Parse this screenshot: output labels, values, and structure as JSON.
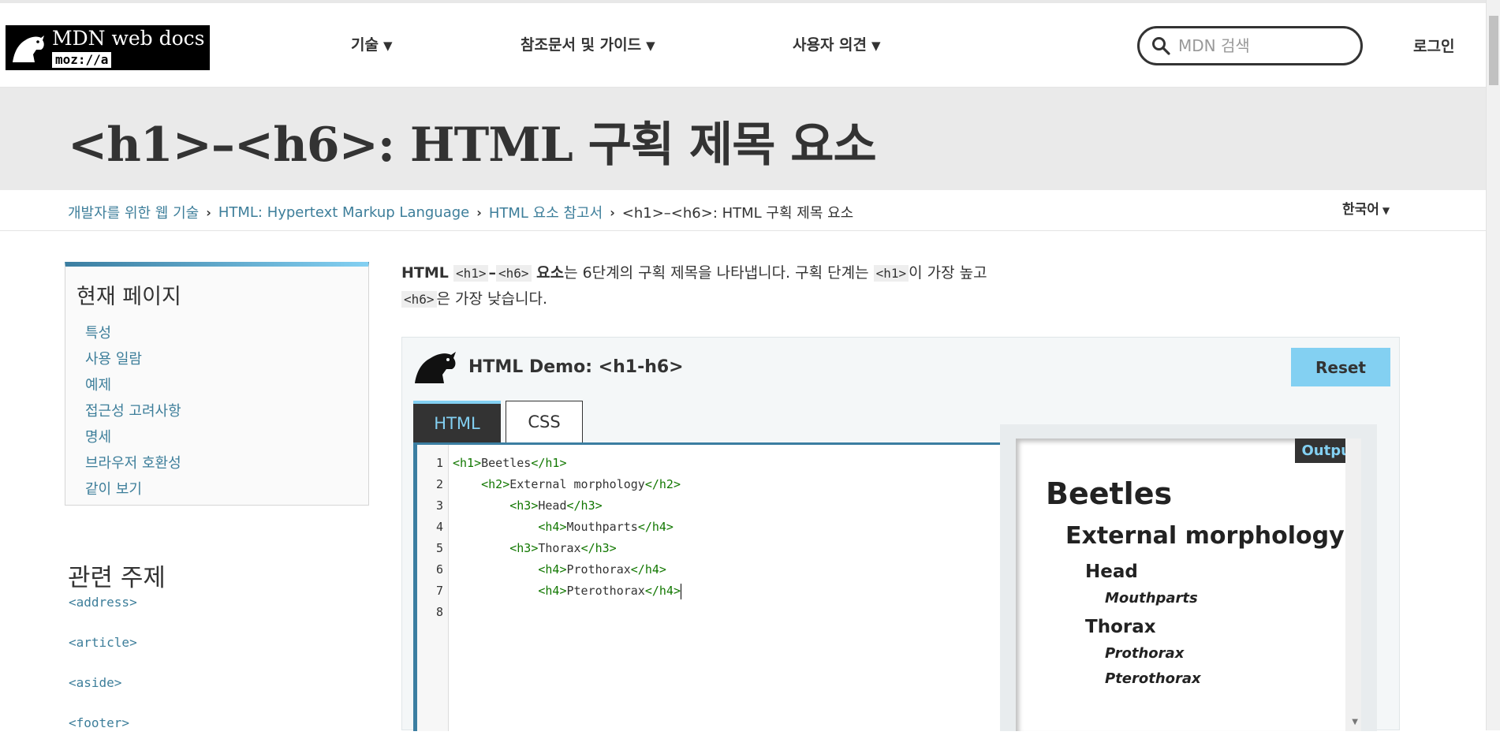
{
  "header": {
    "logo_title": "MDN web docs",
    "logo_sub": "moz://a",
    "nav": [
      {
        "label": "기술"
      },
      {
        "label": "참조문서 및 가이드"
      },
      {
        "label": "사용자 의견"
      }
    ],
    "search_placeholder": "MDN 검색",
    "login": "로그인"
  },
  "page_title": "<h1>–<h6>: HTML 구획 제목 요소",
  "breadcrumbs": [
    "개발자를 위한 웹 기술",
    "HTML: Hypertext Markup Language",
    "HTML 요소 참고서",
    "<h1>–<h6>: HTML 구획 제목 요소"
  ],
  "language": "한국어",
  "toc": {
    "title": "현재 페이지",
    "items": [
      "특성",
      "사용 일람",
      "예제",
      "접근성 고려사항",
      "명세",
      "브라우저 호환성",
      "같이 보기"
    ]
  },
  "related": {
    "title": "관련 주제",
    "items": [
      "<address>",
      "<article>",
      "<aside>",
      "<footer>"
    ]
  },
  "intro": {
    "lead": "HTML",
    "code1": "<h1>",
    "dash": "–",
    "code2": "<h6>",
    "bold_tail": " 요소",
    "text1": "는 6단계의 구획 제목을 나타냅니다. 구획 단계는 ",
    "code3": "<h1>",
    "text2": "이 가장 높고",
    "code4": "<h6>",
    "text3": "은 가장 낮습니다."
  },
  "demo": {
    "title": "HTML Demo: <h1-h6>",
    "reset": "Reset",
    "tabs": [
      "HTML",
      "CSS"
    ],
    "line_numbers": [
      "1",
      "2",
      "3",
      "4",
      "5",
      "6",
      "7",
      "8"
    ],
    "code_lines": [
      {
        "indent": "",
        "open": "<h1>",
        "text": "Beetles",
        "close": "</h1>"
      },
      {
        "indent": "    ",
        "open": "<h2>",
        "text": "External morphology",
        "close": "</h2>"
      },
      {
        "indent": "        ",
        "open": "<h3>",
        "text": "Head",
        "close": "</h3>"
      },
      {
        "indent": "            ",
        "open": "<h4>",
        "text": "Mouthparts",
        "close": "</h4>"
      },
      {
        "indent": "        ",
        "open": "<h3>",
        "text": "Thorax",
        "close": "</h3>"
      },
      {
        "indent": "            ",
        "open": "<h4>",
        "text": "Prothorax",
        "close": "</h4>"
      },
      {
        "indent": "            ",
        "open": "<h4>",
        "text": "Pterothorax",
        "close": "</h4>"
      }
    ],
    "output_label": "Output",
    "output": {
      "h1": "Beetles",
      "h2": "External morphology",
      "h3a": "Head",
      "h4a": "Mouthparts",
      "h3b": "Thorax",
      "h4b": "Prothorax",
      "h4c": "Pterothorax"
    }
  }
}
